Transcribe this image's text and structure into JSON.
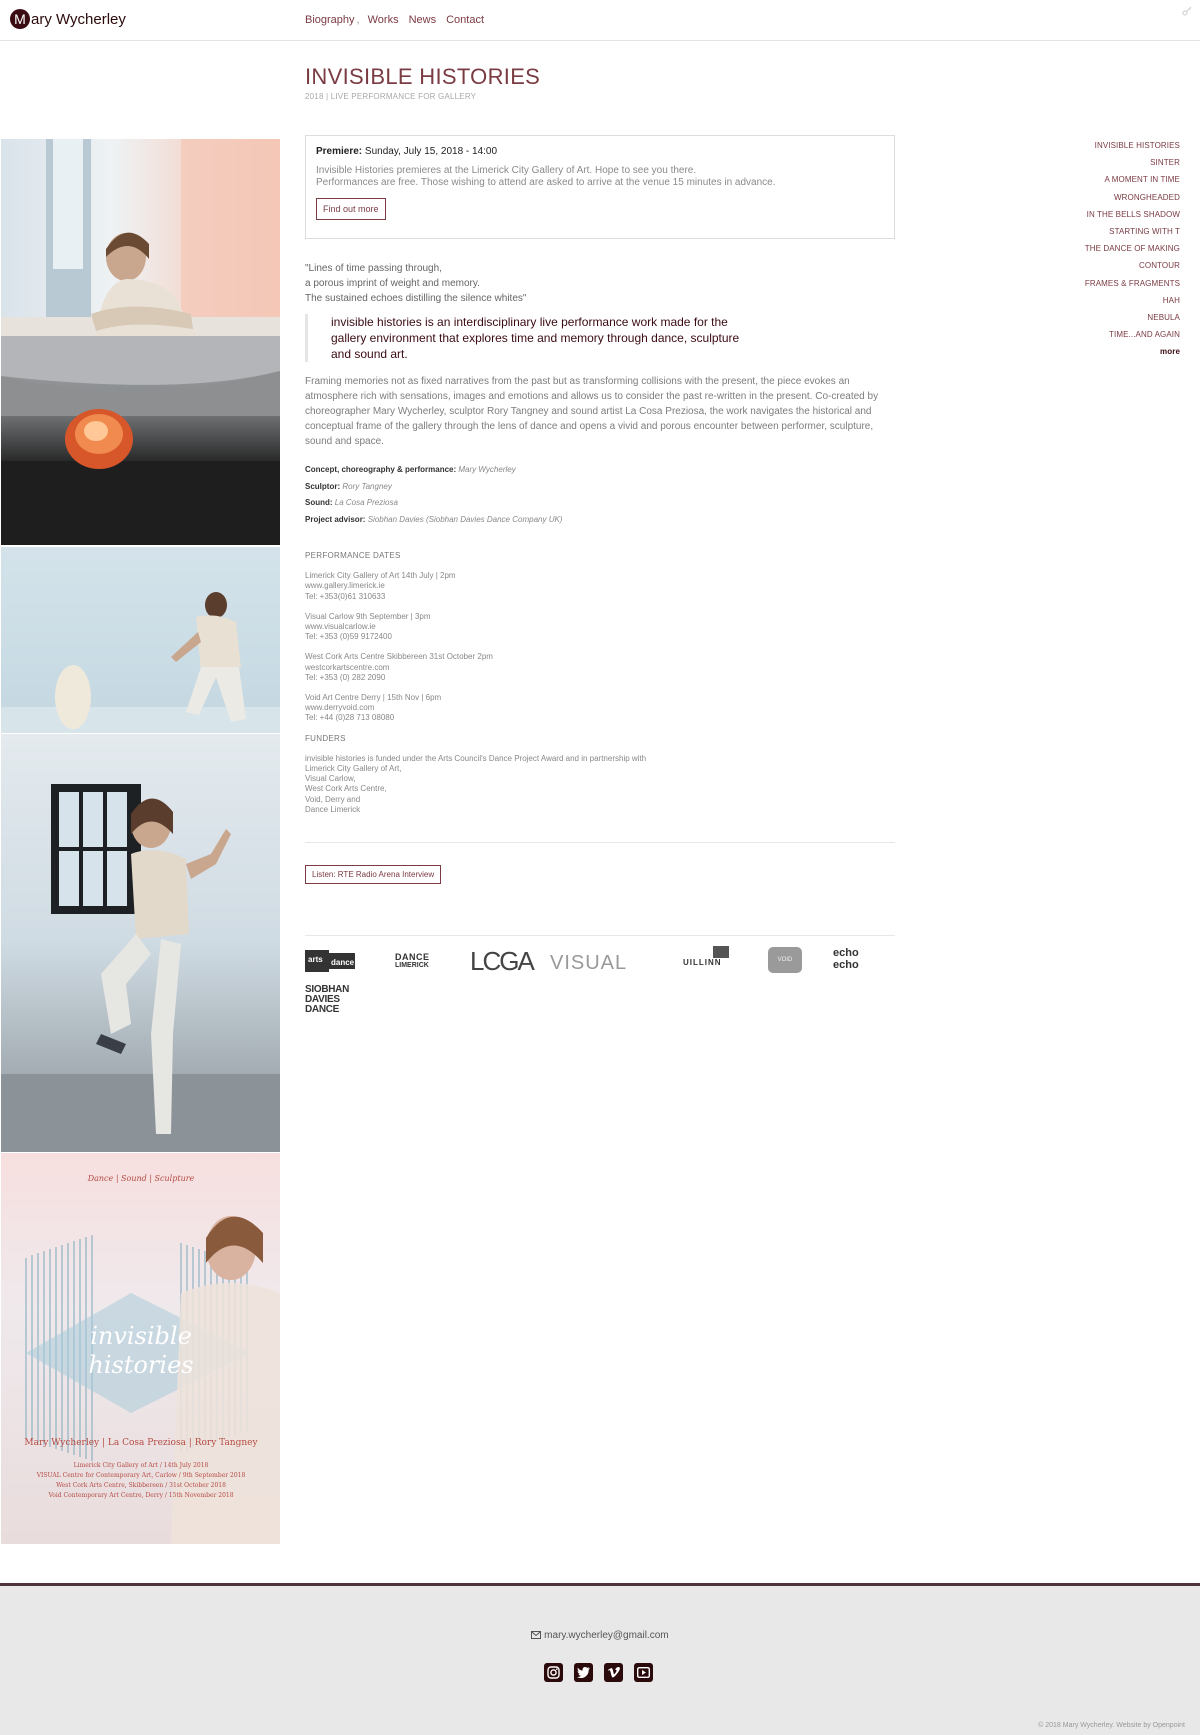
{
  "header": {
    "logo_initial": "M",
    "logo_text": "ary Wycherley",
    "nav": [
      "Biography",
      "Works",
      "News",
      "Contact"
    ],
    "nav_separator": ","
  },
  "page": {
    "title": "INVISIBLE HISTORIES",
    "subtitle": "2018 | LIVE PERFORMANCE FOR GALLERY"
  },
  "premiere": {
    "label": "Premiere:",
    "date": "Sunday, July 15, 2018 - 14:00",
    "line1": "Invisible Histories premieres at the Limerick City Gallery of Art. Hope to see you there.",
    "line2": "Performances are free. Those wishing to attend are asked to arrive at the venue 15 minutes in advance.",
    "button": "Find out more"
  },
  "poem": [
    "\"Lines of time passing through,",
    "a porous imprint of weight and memory.",
    "The sustained echoes distilling the silence whites\""
  ],
  "quote": "invisible histories is an interdisciplinary live performance work made for the gallery environment that explores time and memory through dance, sculpture and sound art.",
  "description": "Framing memories not as fixed narratives from the past but as transforming collisions with the present, the piece evokes an atmosphere rich with sensations, images and emotions and allows us to consider the past re-written in the present. Co-created by choreographer Mary Wycherley, sculptor Rory Tangney and sound artist La Cosa Preziosa, the work navigates the historical and conceptual frame of the gallery through the lens of dance and opens a vivid and porous encounter between performer, sculpture, sound and space.",
  "credits": [
    {
      "label": "Concept, choreography & performance:",
      "value": "Mary Wycherley"
    },
    {
      "label": "Sculptor:",
      "value": "Rory Tangney"
    },
    {
      "label": "Sound:",
      "value": "La Cosa Preziosa"
    },
    {
      "label": "Project advisor:",
      "value": "Siobhan Davies (Siobhan Davies Dance Company UK)"
    }
  ],
  "performance": {
    "heading": "PERFORMANCE DATES",
    "venues": [
      [
        "Limerick City Gallery of Art 14th July | 2pm",
        "www.gallery.limerick.ie",
        "Tel: +353(0)61 310633"
      ],
      [
        "Visual Carlow 9th September | 3pm",
        "www.visualcarlow.ie",
        "Tel: +353 (0)59 9172400"
      ],
      [
        "West Cork Arts Centre Skibbereen 31st October 2pm",
        "westcorkartscentre.com",
        "Tel: +353 (0) 282 2090"
      ],
      [
        "Void Art Centre Derry | 15th Nov | 6pm",
        "www.derryvoid.com",
        "Tel: +44 (0)28 713 08080"
      ]
    ],
    "funders_heading": "FUNDERS",
    "funders": [
      "invisible histories is funded under the Arts Council's Dance Project Award and in partnership with",
      "Limerick City Gallery of Art,",
      "Visual Carlow,",
      "West Cork Arts Centre,",
      "Void, Derry and",
      "Dance Limerick"
    ]
  },
  "listen_button": "Listen: RTE Radio Arena Interview",
  "logos": {
    "arts_council_1": "arts",
    "arts_council_2": "dance",
    "dance_limerick_1": "DANCE",
    "dance_limerick_2": "LIMERICK",
    "lcga": "LCGA",
    "visual": "VISUAL",
    "uillinn": "UILLINN",
    "void": "VOID",
    "echo_1": "echo",
    "echo_2": "echo",
    "siobhan_1": "SIOBHAN",
    "siobhan_2": "DAVIES",
    "siobhan_3": "DANCE"
  },
  "poster": {
    "tagline": "Dance | Sound | Sculpture",
    "title_1": "invisible",
    "title_2": "histories",
    "names": "Mary Wycherley | La Cosa Preziosa | Rory Tangney",
    "dates": [
      "Limerick City Gallery of Art / 14th July 2018",
      "VISUAL Centre for Contemporary Art, Carlow / 9th September 2018",
      "West Cork Arts Centre, Skibbereen / 31st October 2018",
      "Void Contemporary Art Centre, Derry / 15th November 2018"
    ]
  },
  "sidebar": [
    "INVISIBLE HISTORIES",
    "SINTER",
    "A MOMENT IN TIME",
    "WRONGHEADED",
    "IN THE BELLS SHADOW",
    "STARTING WITH T",
    "THE DANCE OF MAKING",
    "CONTOUR",
    "FRAMES & FRAGMENTS",
    "HAH",
    "NEBULA",
    "TIME...AND AGAIN"
  ],
  "sidebar_more": "more",
  "footer": {
    "email": "mary.wycherley@gmail.com",
    "social": [
      "instagram-icon",
      "twitter-icon",
      "vimeo-icon",
      "youtube-icon"
    ],
    "copyright": "© 2018 Mary Wycherley. Website by Openpoint"
  },
  "colors": {
    "accent": "#7a3b43",
    "dark": "#3a0b12",
    "footer_bg": "#e8e8e8"
  }
}
